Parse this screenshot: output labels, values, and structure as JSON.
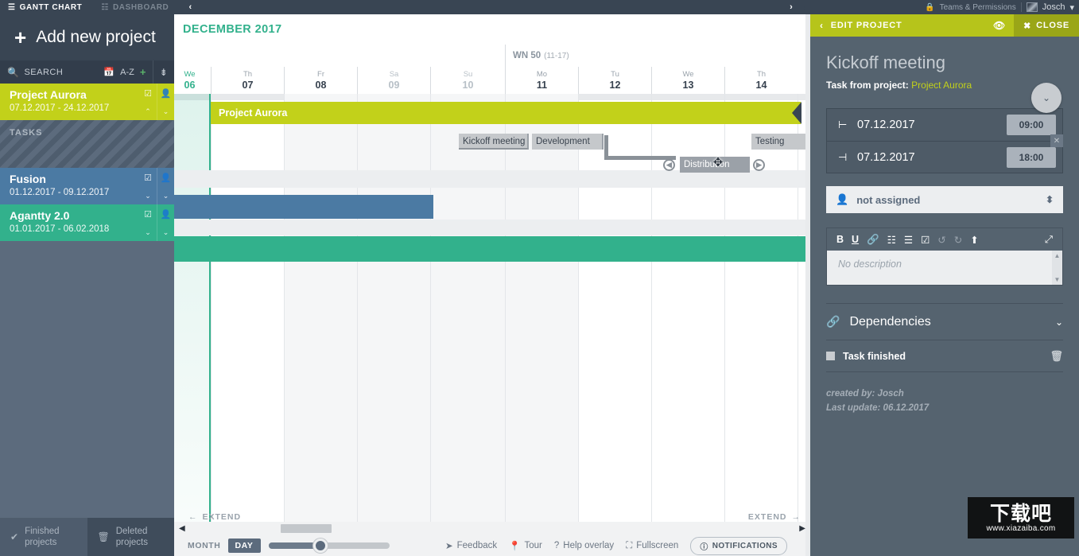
{
  "topbar": {
    "tabs": [
      {
        "label": "GANTT CHART",
        "icon": "gantt-icon",
        "active": true
      },
      {
        "label": "DASHBOARD",
        "icon": "dashboard-icon",
        "active": false
      }
    ],
    "collapse_left": "‹",
    "expand_right": "›",
    "teams_permissions": "Teams & Permissions",
    "lock_icon": "lock-icon",
    "user": "Josch",
    "user_caret": "▾"
  },
  "sidebar": {
    "add_project": "Add new project",
    "add_icon": "+",
    "search": {
      "label": "SEARCH",
      "icon": "search-icon",
      "calendar_icon": "calendar-icon",
      "sort_az": "A-Z",
      "add_icon": "+",
      "sort_icon": "sort-icon"
    },
    "projects": [
      {
        "name": "Project Aurora",
        "dates": "07.12.2017 - 24.12.2017",
        "color": "#c2d11a",
        "check": "☑",
        "person": "person-icon",
        "up": "⌃",
        "down": "⌄"
      },
      {
        "name": "Fusion",
        "dates": "01.12.2017 - 09.12.2017",
        "color": "#4b7aa3",
        "check": "☑",
        "person": "person-icon",
        "up": "⌄",
        "down": "⌄"
      },
      {
        "name": "Agantty 2.0",
        "dates": "01.01.2017 - 06.02.2018",
        "color": "#32b18c",
        "check": "☑",
        "person": "person-icon",
        "up": "⌄",
        "down": "⌄"
      }
    ],
    "tasks_label": "TASKS",
    "bottom": [
      {
        "label_line1": "Finished",
        "label_line2": "projects",
        "icon": "check-icon"
      },
      {
        "label_line1": "Deleted",
        "label_line2": "projects",
        "icon": "trash-icon"
      }
    ]
  },
  "gantt": {
    "month": "DECEMBER 2017",
    "week_number": {
      "label": "WN 50",
      "range": "(11-17)"
    },
    "days": [
      {
        "weekday": "We",
        "daynum": "06",
        "weekend": false,
        "today": true
      },
      {
        "weekday": "Th",
        "daynum": "07",
        "weekend": false,
        "today": false
      },
      {
        "weekday": "Fr",
        "daynum": "08",
        "weekend": false,
        "today": false
      },
      {
        "weekday": "Sa",
        "daynum": "09",
        "weekend": true,
        "today": false
      },
      {
        "weekday": "Su",
        "daynum": "10",
        "weekend": true,
        "today": false
      },
      {
        "weekday": "Mo",
        "daynum": "11",
        "weekend": false,
        "today": false
      },
      {
        "weekday": "Tu",
        "daynum": "12",
        "weekend": false,
        "today": false
      },
      {
        "weekday": "We",
        "daynum": "13",
        "weekend": false,
        "today": false
      },
      {
        "weekday": "Th",
        "daynum": "14",
        "weekend": false,
        "today": false
      }
    ],
    "project_bands": [
      {
        "name": "Project Aurora",
        "color": "#c2d11a"
      },
      {
        "name": "",
        "color": "#4b7aa3"
      },
      {
        "name": "",
        "color": "#32b18c"
      }
    ],
    "tasks": [
      {
        "name": "Kickoff meeting",
        "selected": false
      },
      {
        "name": "Development",
        "selected": false
      },
      {
        "name": "Testing",
        "selected": true
      },
      {
        "name": "Distribution",
        "selected": false
      }
    ],
    "extend_left": "EXTEND",
    "extend_right": "EXTEND",
    "extend_left_icon": "←",
    "extend_right_icon": "→",
    "zoom": {
      "month": "MONTH",
      "day": "DAY",
      "selected": "DAY"
    },
    "scroll_left_icon": "◀",
    "scroll_right_icon": "▶"
  },
  "bottom_links": [
    {
      "label": "Feedback",
      "icon": "send-icon"
    },
    {
      "label": "Tour",
      "icon": "pin-icon"
    },
    {
      "label": "Help overlay",
      "icon": "question-icon"
    },
    {
      "label": "Fullscreen",
      "icon": "fullscreen-icon"
    }
  ],
  "notifications": {
    "label": "NOTIFICATIONS",
    "icon": "info-icon"
  },
  "panel": {
    "header": {
      "back_icon": "‹",
      "title": "EDIT PROJECT",
      "eye_icon": "eye-icon",
      "close_icon": "✖",
      "close_label": "CLOSE"
    },
    "task_title": "Kickoff meeting",
    "task_from_label": "Task from project:",
    "project_link": "Project Aurora",
    "collapse_icon": "⌄",
    "mini_close": "✕",
    "dates": [
      {
        "icon": "start-icon",
        "date": "07.12.2017",
        "time": "09:00"
      },
      {
        "icon": "end-icon",
        "date": "07.12.2017",
        "time": "18:00"
      }
    ],
    "assignee": {
      "value": "not assigned",
      "icon": "person-icon",
      "spinner_icon": "⬍"
    },
    "editor": {
      "tools": [
        "B",
        "U",
        "link-icon",
        "ordered-list-icon",
        "unordered-list-icon",
        "checklist-icon",
        "undo-icon",
        "redo-icon",
        "upload-icon"
      ],
      "expand_icon": "expand-icon",
      "placeholder": "No description",
      "scroll_up": "▲",
      "scroll_down": "▼"
    },
    "dependencies": {
      "label": "Dependencies",
      "icon": "chain-icon",
      "caret": "⌄"
    },
    "task_finished": {
      "label": "Task finished",
      "checkbox": "unchecked",
      "trash_icon": "trash-icon"
    },
    "meta": {
      "created_by": "created by: Josch",
      "last_update": "Last update: 06.12.2017"
    }
  },
  "watermark": {
    "big": "下载吧",
    "small": "www.xiazaiba.com"
  }
}
